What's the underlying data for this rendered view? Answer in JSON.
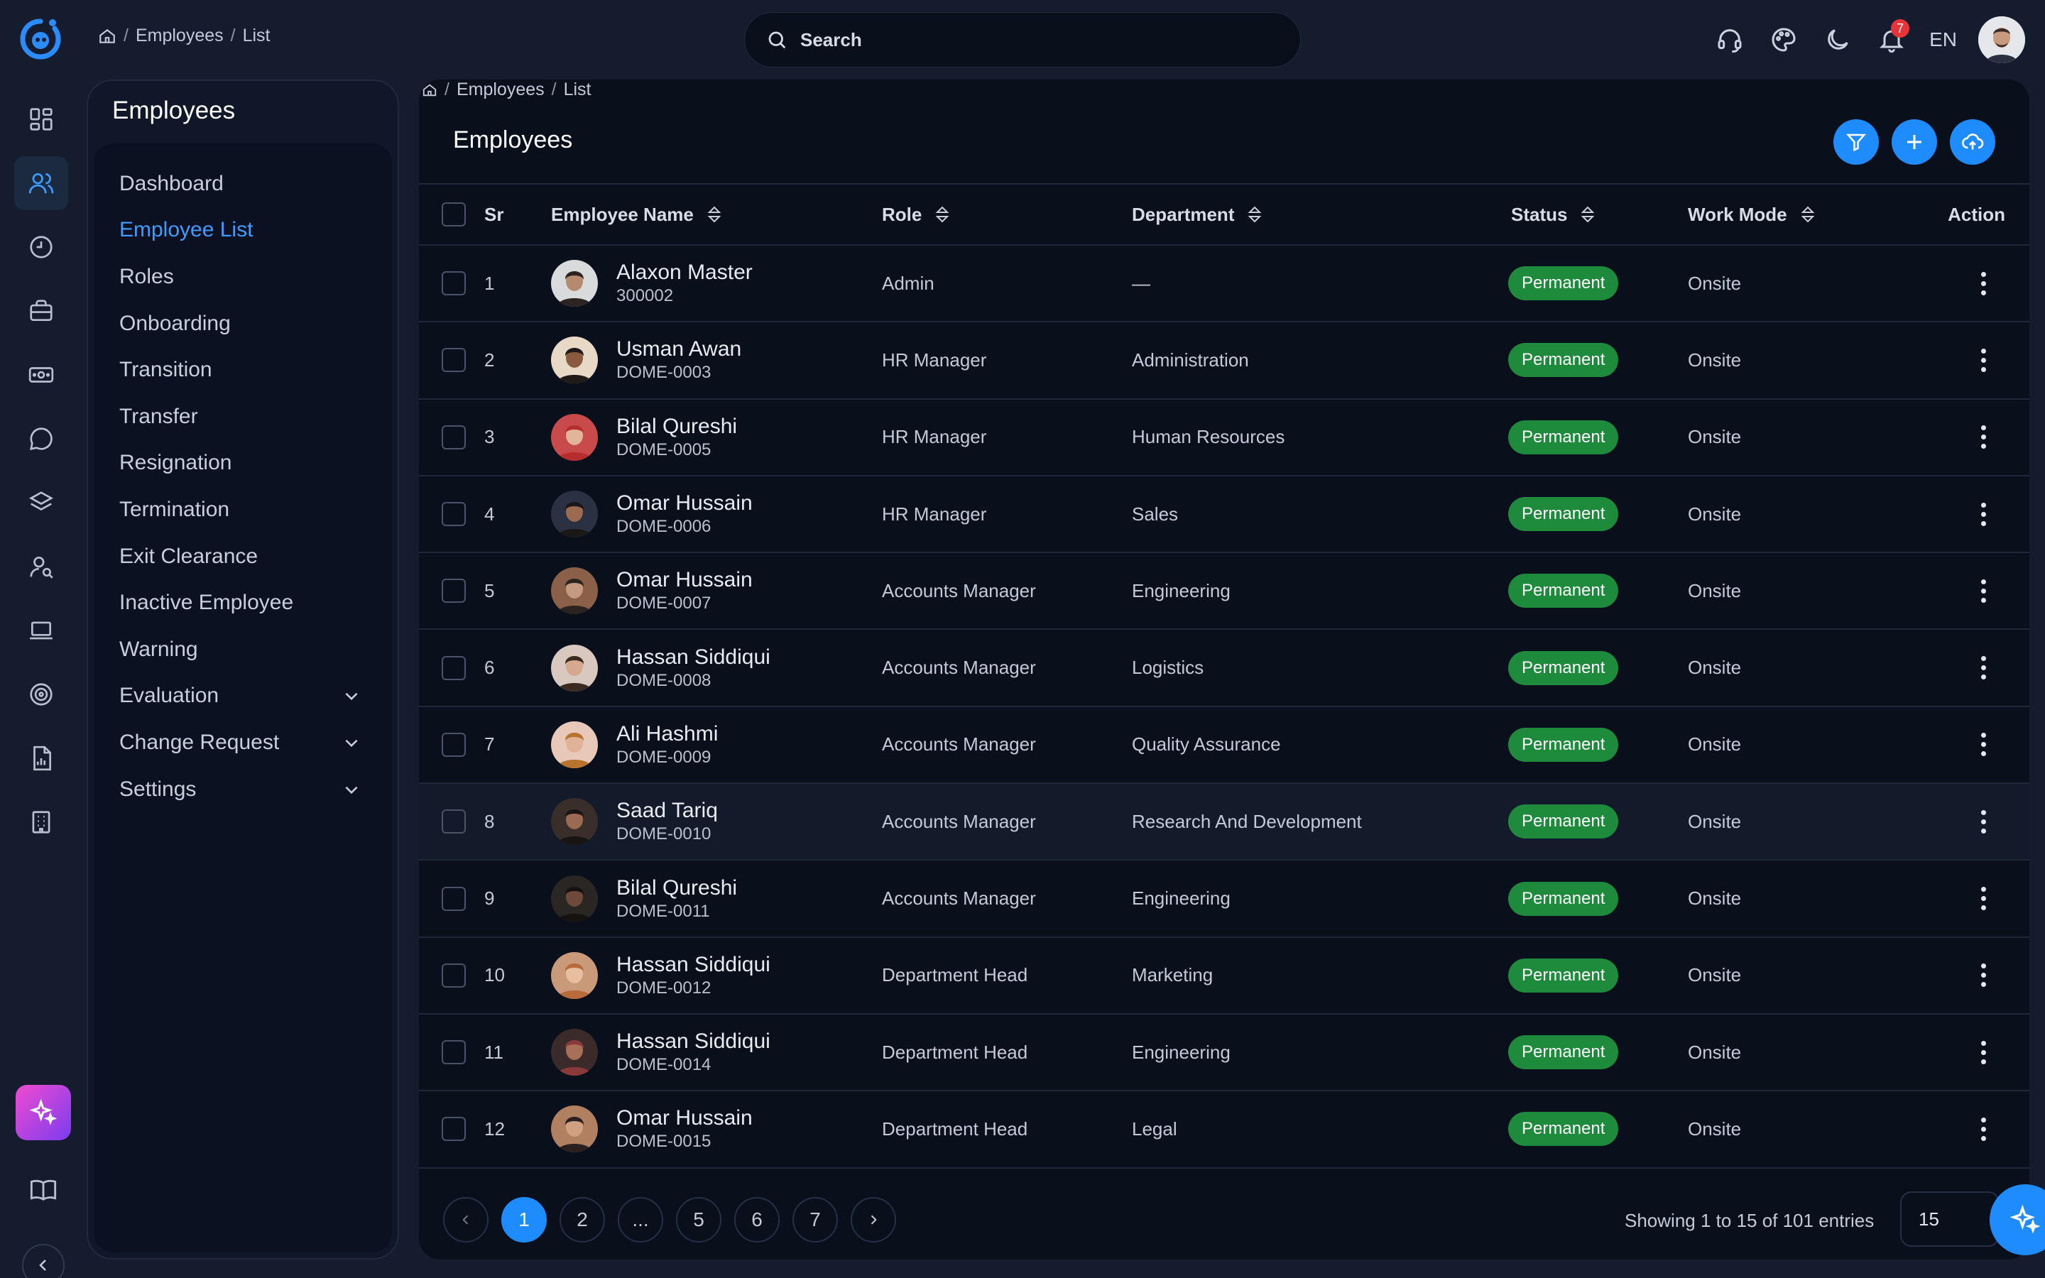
{
  "topbar": {
    "breadcrumb": [
      "Employees",
      "List"
    ],
    "search_label": "Search",
    "notification_count": "7",
    "language": "EN"
  },
  "rail": {
    "icons": [
      "dashboard-grid-icon",
      "users-icon",
      "clock-icon",
      "briefcase-icon",
      "money-icon",
      "chat-icon",
      "layers-icon",
      "user-search-icon",
      "laptop-icon",
      "target-icon",
      "report-icon",
      "building-icon"
    ],
    "bottom": [
      "sparkle-ai-icon",
      "book-icon",
      "chevron-left-icon"
    ]
  },
  "subnav": {
    "title": "Employees",
    "items": [
      {
        "label": "Dashboard"
      },
      {
        "label": "Employee List",
        "active": true
      },
      {
        "label": "Roles"
      },
      {
        "label": "Onboarding"
      },
      {
        "label": "Transition"
      },
      {
        "label": "Transfer"
      },
      {
        "label": "Resignation"
      },
      {
        "label": "Termination"
      },
      {
        "label": "Exit Clearance"
      },
      {
        "label": "Inactive Employee"
      },
      {
        "label": "Warning"
      },
      {
        "label": "Evaluation",
        "expandable": true
      },
      {
        "label": "Change Request",
        "expandable": true
      },
      {
        "label": "Settings",
        "expandable": true
      }
    ]
  },
  "main": {
    "breadcrumb": [
      "Employees",
      "List"
    ],
    "title": "Employees",
    "columns": [
      "Sr",
      "Employee Name",
      "Role",
      "Department",
      "Status",
      "Work Mode",
      "Action"
    ],
    "rows": [
      {
        "sr": "1",
        "name": "Alaxon Master",
        "code": "300002",
        "role": "Admin",
        "department": "—",
        "status": "Permanent",
        "mode": "Onsite"
      },
      {
        "sr": "2",
        "name": "Usman Awan",
        "code": "DOME-0003",
        "role": "HR Manager",
        "department": "Administration",
        "status": "Permanent",
        "mode": "Onsite"
      },
      {
        "sr": "3",
        "name": "Bilal Qureshi",
        "code": "DOME-0005",
        "role": "HR Manager",
        "department": "Human Resources",
        "status": "Permanent",
        "mode": "Onsite"
      },
      {
        "sr": "4",
        "name": "Omar Hussain",
        "code": "DOME-0006",
        "role": "HR Manager",
        "department": "Sales",
        "status": "Permanent",
        "mode": "Onsite"
      },
      {
        "sr": "5",
        "name": "Omar Hussain",
        "code": "DOME-0007",
        "role": "Accounts Manager",
        "department": "Engineering",
        "status": "Permanent",
        "mode": "Onsite"
      },
      {
        "sr": "6",
        "name": "Hassan Siddiqui",
        "code": "DOME-0008",
        "role": "Accounts Manager",
        "department": "Logistics",
        "status": "Permanent",
        "mode": "Onsite"
      },
      {
        "sr": "7",
        "name": "Ali Hashmi",
        "code": "DOME-0009",
        "role": "Accounts Manager",
        "department": "Quality Assurance",
        "status": "Permanent",
        "mode": "Onsite"
      },
      {
        "sr": "8",
        "name": "Saad Tariq",
        "code": "DOME-0010",
        "role": "Accounts Manager",
        "department": "Research And Development",
        "status": "Permanent",
        "mode": "Onsite"
      },
      {
        "sr": "9",
        "name": "Bilal Qureshi",
        "code": "DOME-0011",
        "role": "Accounts Manager",
        "department": "Engineering",
        "status": "Permanent",
        "mode": "Onsite"
      },
      {
        "sr": "10",
        "name": "Hassan Siddiqui",
        "code": "DOME-0012",
        "role": "Department Head",
        "department": "Marketing",
        "status": "Permanent",
        "mode": "Onsite"
      },
      {
        "sr": "11",
        "name": "Hassan Siddiqui",
        "code": "DOME-0014",
        "role": "Department Head",
        "department": "Engineering",
        "status": "Permanent",
        "mode": "Onsite"
      },
      {
        "sr": "12",
        "name": "Omar Hussain",
        "code": "DOME-0015",
        "role": "Department Head",
        "department": "Legal",
        "status": "Permanent",
        "mode": "Onsite"
      }
    ],
    "pagination": {
      "pages": [
        "1",
        "2",
        "...",
        "5",
        "6",
        "7"
      ],
      "current": "1",
      "showing": "Showing 1 to 15 of 101 entries",
      "per_page": "15"
    }
  },
  "colors": {
    "accent": "#1e8bff",
    "status_permanent": "#1e8a3c",
    "active_nav": "#3f9bff"
  }
}
